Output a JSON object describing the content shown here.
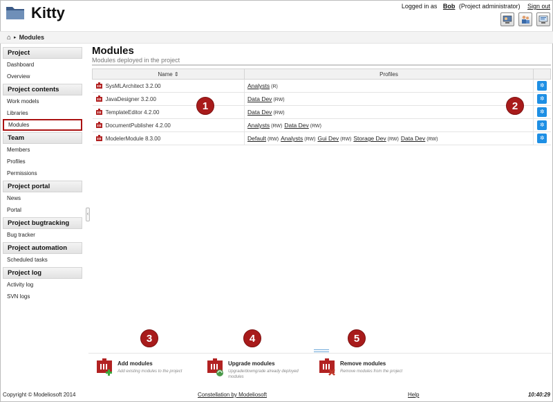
{
  "app": {
    "title": "Kitty"
  },
  "header": {
    "logged_in_as": "Logged in as",
    "user": "Bob",
    "role": "(Project administrator)",
    "sign_out": "Sign out"
  },
  "breadcrumb": {
    "home_icon": "home-icon",
    "current": "Modules"
  },
  "sidebar": {
    "sections": [
      {
        "title": "Project",
        "items": [
          "Dashboard",
          "Overview"
        ]
      },
      {
        "title": "Project contents",
        "items": [
          "Work models",
          "Libraries",
          "Modules"
        ]
      },
      {
        "title": "Team",
        "items": [
          "Members",
          "Profiles",
          "Permissions"
        ]
      },
      {
        "title": "Project portal",
        "items": [
          "News",
          "Portal"
        ]
      },
      {
        "title": "Project bugtracking",
        "items": [
          "Bug tracker"
        ]
      },
      {
        "title": "Project automation",
        "items": [
          "Scheduled tasks"
        ]
      },
      {
        "title": "Project log",
        "items": [
          "Activity log",
          "SVN logs"
        ]
      }
    ],
    "active": "Modules"
  },
  "main": {
    "title": "Modules",
    "subtitle": "Modules deployed in the project",
    "table": {
      "headers": {
        "name": "Name ⇕",
        "profiles": "Profiles"
      },
      "rows": [
        {
          "name": "SysMLArchitect 3.2.00",
          "profiles": [
            {
              "label": "Analysts",
              "mode": "(R)"
            }
          ]
        },
        {
          "name": "JavaDesigner 3.2.00",
          "profiles": [
            {
              "label": "Data Dev",
              "mode": "(RW)"
            }
          ]
        },
        {
          "name": "TemplateEditor 4.2.00",
          "profiles": [
            {
              "label": "Data Dev",
              "mode": "(RW)"
            }
          ]
        },
        {
          "name": "DocumentPublisher 4.2.00",
          "profiles": [
            {
              "label": "Analysts",
              "mode": "(RW)"
            },
            {
              "label": "Data Dev",
              "mode": "(RW)"
            }
          ]
        },
        {
          "name": "ModelerModule 8.3.00",
          "profiles": [
            {
              "label": "Default",
              "mode": "(RW)"
            },
            {
              "label": "Analysts",
              "mode": "(RW)"
            },
            {
              "label": "Gui Dev",
              "mode": "(RW)"
            },
            {
              "label": "Storage Dev",
              "mode": "(RW)"
            },
            {
              "label": "Data Dev",
              "mode": "(RW)"
            }
          ]
        }
      ]
    },
    "markers": [
      "1",
      "2",
      "3",
      "4",
      "5"
    ]
  },
  "actions": [
    {
      "title": "Add modules",
      "desc": "Add existing modules to the project",
      "icon": "add-module-icon"
    },
    {
      "title": "Upgrade modules",
      "desc": "Upgrade/downgrade already deployed modules",
      "icon": "upgrade-module-icon"
    },
    {
      "title": "Remove modules",
      "desc": "Remove modules from the project",
      "icon": "remove-module-icon"
    }
  ],
  "footer": {
    "copyright": "Copyright © Modeliosoft 2014",
    "center": "Constellation by Modeliosoft",
    "help": "Help",
    "time": "10:40:29"
  },
  "colors": {
    "accent": "#1e8fe4",
    "marker": "#a81b1b",
    "module_icon": "#b22222"
  }
}
